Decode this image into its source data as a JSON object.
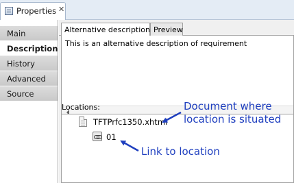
{
  "view_tab": {
    "title": "Properties",
    "close_glyph": "✕"
  },
  "sidebar": {
    "items": [
      {
        "label": "Main"
      },
      {
        "label": "Description"
      },
      {
        "label": "History"
      },
      {
        "label": "Advanced"
      },
      {
        "label": "Source"
      }
    ],
    "active_index": 1
  },
  "main": {
    "tabs": [
      {
        "label": "Alternative description:"
      },
      {
        "label": "Preview"
      }
    ],
    "description_text": "This is an alternative description of requirement",
    "locations_label": "Locations:",
    "tree": {
      "document": "TFTPrfc1350.xhtml",
      "link": "01"
    }
  },
  "annotations": {
    "document_callout_line1": "Document where",
    "document_callout_line2": "location is situated",
    "link_callout": "Link to location",
    "arrow_color": "#1f3fbf"
  },
  "icons": {
    "view_tab": "properties-icon",
    "document": "document-icon",
    "link": "link-icon"
  }
}
